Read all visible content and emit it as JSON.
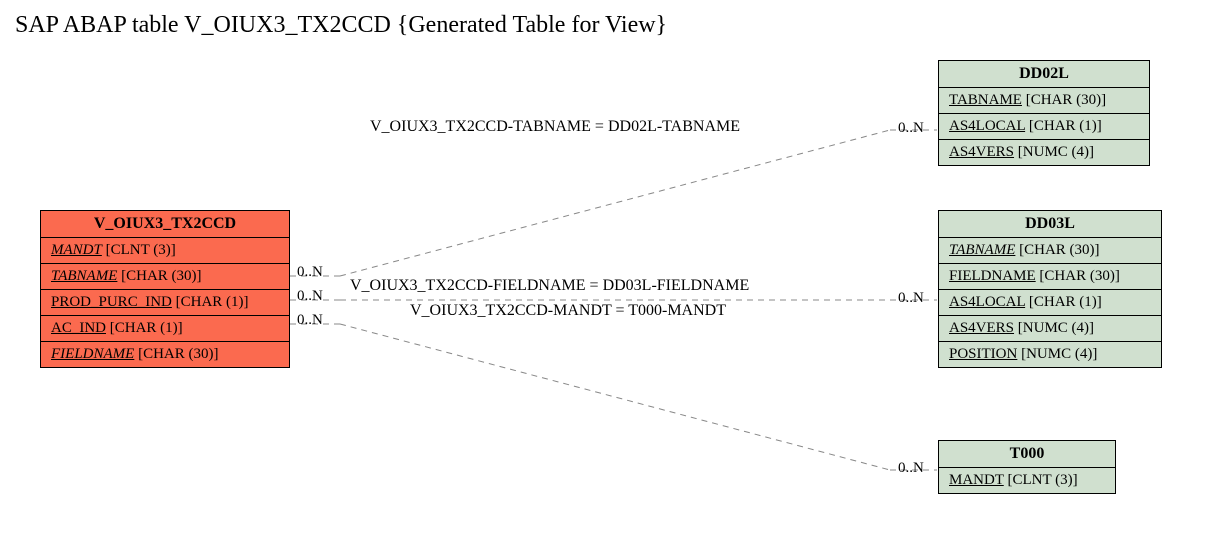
{
  "title": "SAP ABAP table V_OIUX3_TX2CCD {Generated Table for View}",
  "main_entity": {
    "name": "V_OIUX3_TX2CCD",
    "fields": [
      {
        "name": "MANDT",
        "type": "[CLNT (3)]",
        "underline": true,
        "italic": true
      },
      {
        "name": "TABNAME",
        "type": "[CHAR (30)]",
        "underline": true,
        "italic": true
      },
      {
        "name": "PROD_PURC_IND",
        "type": "[CHAR (1)]",
        "underline": true,
        "italic": false
      },
      {
        "name": "AC_IND",
        "type": "[CHAR (1)]",
        "underline": true,
        "italic": false
      },
      {
        "name": "FIELDNAME",
        "type": "[CHAR (30)]",
        "underline": true,
        "italic": true
      }
    ]
  },
  "related": [
    {
      "name": "DD02L",
      "fields": [
        {
          "name": "TABNAME",
          "type": "[CHAR (30)]",
          "underline": true,
          "italic": false
        },
        {
          "name": "AS4LOCAL",
          "type": "[CHAR (1)]",
          "underline": true,
          "italic": false
        },
        {
          "name": "AS4VERS",
          "type": "[NUMC (4)]",
          "underline": true,
          "italic": false
        }
      ]
    },
    {
      "name": "DD03L",
      "fields": [
        {
          "name": "TABNAME",
          "type": "[CHAR (30)]",
          "underline": true,
          "italic": true
        },
        {
          "name": "FIELDNAME",
          "type": "[CHAR (30)]",
          "underline": true,
          "italic": false
        },
        {
          "name": "AS4LOCAL",
          "type": "[CHAR (1)]",
          "underline": true,
          "italic": false
        },
        {
          "name": "AS4VERS",
          "type": "[NUMC (4)]",
          "underline": true,
          "italic": false
        },
        {
          "name": "POSITION",
          "type": "[NUMC (4)]",
          "underline": true,
          "italic": false
        }
      ]
    },
    {
      "name": "T000",
      "fields": [
        {
          "name": "MANDT",
          "type": "[CLNT (3)]",
          "underline": true,
          "italic": false
        }
      ]
    }
  ],
  "relations": [
    {
      "label": "V_OIUX3_TX2CCD-TABNAME = DD02L-TABNAME",
      "left_card": "0..N",
      "right_card": "0..N"
    },
    {
      "label": "V_OIUX3_TX2CCD-FIELDNAME = DD03L-FIELDNAME",
      "left_card": "0..N",
      "right_card": "0..N"
    },
    {
      "label": "V_OIUX3_TX2CCD-MANDT = T000-MANDT",
      "left_card": "0..N",
      "right_card": "0..N"
    }
  ]
}
